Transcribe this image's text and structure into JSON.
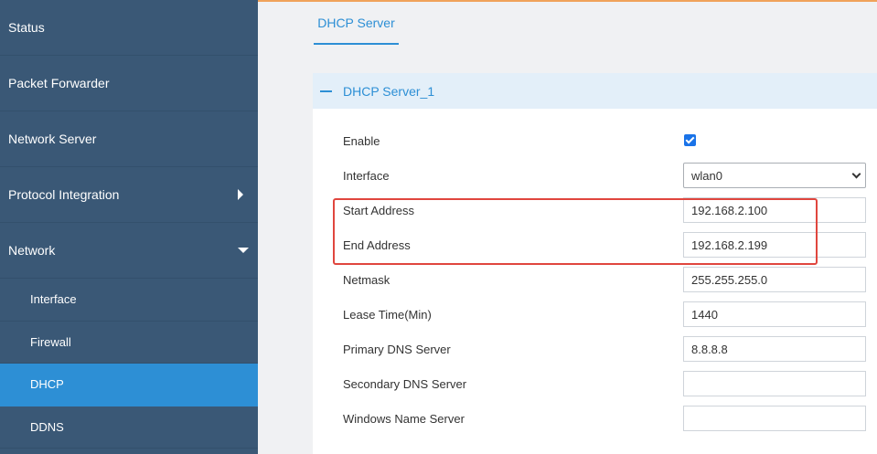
{
  "sidebar": {
    "items": [
      {
        "label": "Status"
      },
      {
        "label": "Packet Forwarder"
      },
      {
        "label": "Network Server"
      },
      {
        "label": "Protocol Integration"
      },
      {
        "label": "Network"
      }
    ],
    "subitems": [
      {
        "label": "Interface"
      },
      {
        "label": "Firewall"
      },
      {
        "label": "DHCP"
      },
      {
        "label": "DDNS"
      }
    ],
    "active_subitem": "DHCP"
  },
  "tabs": [
    {
      "label": "DHCP Server"
    }
  ],
  "panel": {
    "title": "DHCP Server_1",
    "fields": {
      "enable": {
        "label": "Enable",
        "checked": true
      },
      "interface": {
        "label": "Interface",
        "value": "wlan0"
      },
      "start_address": {
        "label": "Start Address",
        "value": "192.168.2.100"
      },
      "end_address": {
        "label": "End Address",
        "value": "192.168.2.199"
      },
      "netmask": {
        "label": "Netmask",
        "value": "255.255.255.0"
      },
      "lease_time": {
        "label": "Lease Time(Min)",
        "value": "1440"
      },
      "primary_dns": {
        "label": "Primary DNS Server",
        "value": "8.8.8.8"
      },
      "secondary_dns": {
        "label": "Secondary DNS Server",
        "value": ""
      },
      "windows_name_server": {
        "label": "Windows Name Server",
        "value": ""
      }
    }
  },
  "colors": {
    "sidebar_bg": "#3a5876",
    "accent": "#2d8fd5",
    "highlight": "#e0463e",
    "top_accent": "#f0a25a"
  }
}
